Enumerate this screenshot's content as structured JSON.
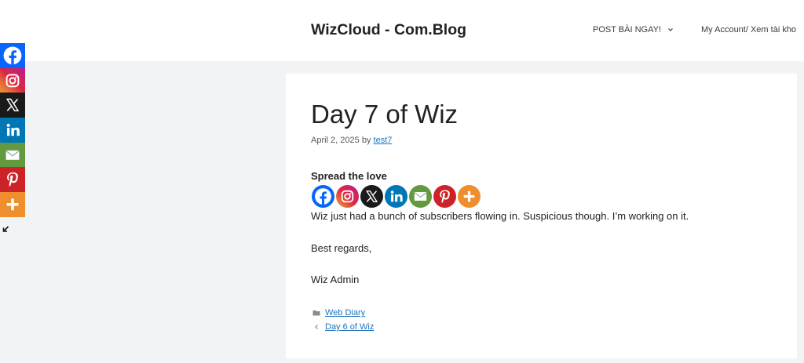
{
  "theme": {
    "page_background": "#F2F3F4",
    "header_background": "#FFFFFF",
    "text": "#222222",
    "link": "#1E73BE"
  },
  "header": {
    "site_title": "WizCloud - Com.Blog",
    "nav": [
      {
        "label": "POST BÀI NGAY!",
        "icon": "chevron-down-icon"
      },
      {
        "label": "My Account/ Xem tài kho"
      }
    ]
  },
  "share_networks": [
    {
      "icon": "facebook-icon",
      "color": "#0765FE"
    },
    {
      "icon": "instagram-icon",
      "colors": [
        "#F09433",
        "#E6683C",
        "#DC2743",
        "#CC2366",
        "#BC1888"
      ]
    },
    {
      "icon": "x-icon",
      "color": "#1A1A1A"
    },
    {
      "icon": "linkedin-icon",
      "color": "#0077B5"
    },
    {
      "icon": "email-icon",
      "color": "#649A3F"
    },
    {
      "icon": "pinterest-icon",
      "color": "#CC2329"
    },
    {
      "icon": "more-icon",
      "color": "#EE8E2D"
    }
  ],
  "floating_share": {
    "hide_icon": "hide-arrow-icon"
  },
  "post": {
    "title": "Day 7 of Wiz",
    "date": "April 2, 2025",
    "by_label": "by",
    "author": "test7",
    "share_heading": "Spread the love",
    "body": [
      "Wiz just had a bunch of subscribers flowing in. Suspicious though. I’m working on it.",
      "Best regards,",
      "Wiz Admin"
    ],
    "category_icon": "folder-icon",
    "category": "Web Diary",
    "previous_icon": "chevron-left-icon",
    "previous_post": "Day 6 of Wiz"
  }
}
